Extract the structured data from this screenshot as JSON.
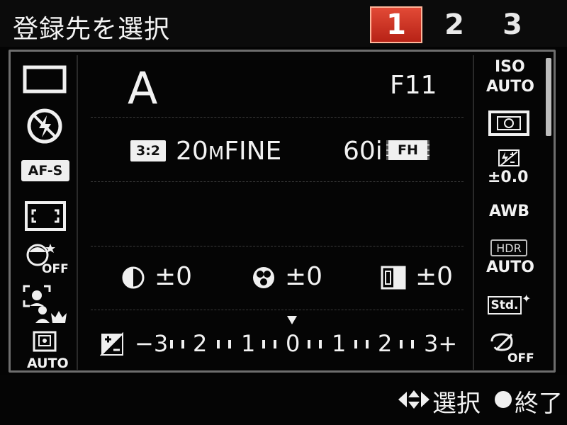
{
  "header": {
    "title": "登録先を選択",
    "tabs": [
      {
        "label": "1",
        "active": true
      },
      {
        "label": "2",
        "active": false
      },
      {
        "label": "3",
        "active": false
      }
    ]
  },
  "left_icons": [
    {
      "name": "aspect-frame-icon"
    },
    {
      "name": "flash-off-icon"
    },
    {
      "name": "af-mode-icon",
      "label": "AF-S"
    },
    {
      "name": "af-area-icon"
    },
    {
      "name": "face-retouch-icon",
      "label": "OFF"
    },
    {
      "name": "face-priority-icon"
    },
    {
      "name": "auto-frame-icon",
      "label": "AUTO"
    }
  ],
  "main": {
    "mode": "A",
    "aperture": "F11",
    "aspect": "3:2",
    "image_size": "20",
    "image_size_unit": "M",
    "quality": "FINE",
    "video_rate": "60i",
    "video_format": "FH",
    "contrast_value": "±0",
    "saturation_value": "±0",
    "sharpness_value": "±0",
    "exposure_comp_value": 0,
    "exposure_scale": [
      "−3",
      "2",
      "1",
      "0",
      "1",
      "2",
      "3+"
    ]
  },
  "right_icons": {
    "iso_label": "ISO",
    "iso_value": "AUTO",
    "flash_comp_value": "±0.0",
    "white_balance": "AWB",
    "hdr_label": "HDR",
    "hdr_value": "AUTO",
    "picture_style": "Std.",
    "creative_off": "OFF"
  },
  "footer": {
    "select_label": "選択",
    "end_label": "終了"
  }
}
